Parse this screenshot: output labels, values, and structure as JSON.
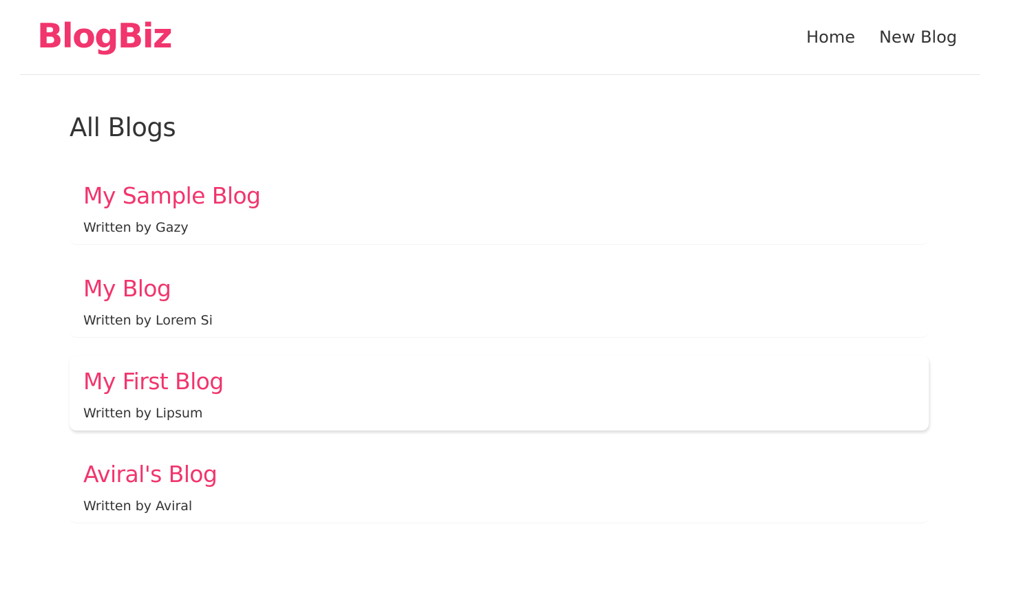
{
  "navbar": {
    "brand": "BlogBiz",
    "links": [
      {
        "label": "Home"
      },
      {
        "label": "New Blog"
      }
    ]
  },
  "main": {
    "title": "All Blogs",
    "blogs": [
      {
        "title": "My Sample Blog",
        "author_line": "Written by Gazy"
      },
      {
        "title": "My Blog",
        "author_line": "Written by Lorem Si"
      },
      {
        "title": "My First Blog",
        "author_line": "Written by Lipsum"
      },
      {
        "title": "Aviral's Blog",
        "author_line": "Written by Aviral"
      }
    ]
  },
  "colors": {
    "accent": "#f1356d",
    "text": "#333333",
    "divider": "#e6e6e6"
  }
}
